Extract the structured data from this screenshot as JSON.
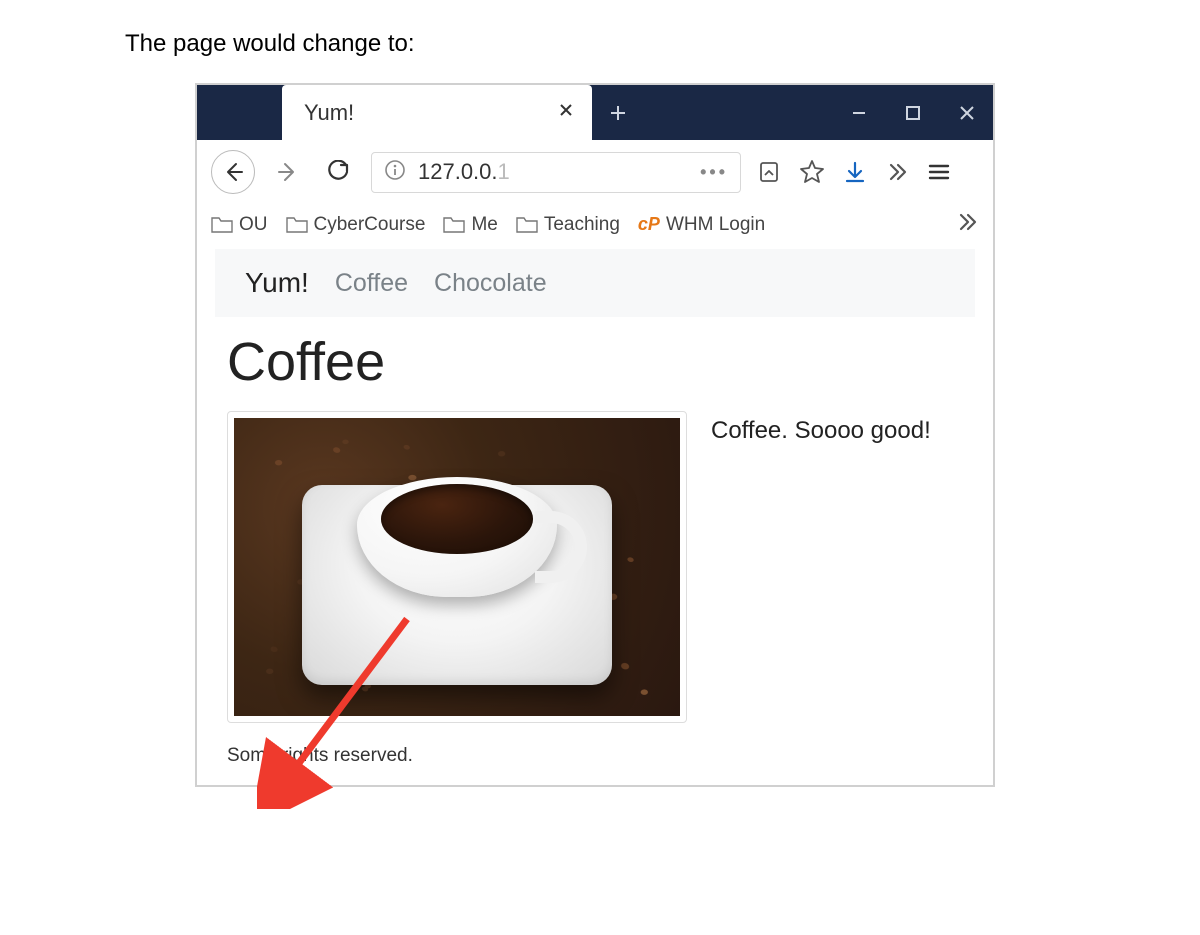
{
  "intro_caption": "The page would change to:",
  "browser": {
    "tab_title": "Yum!",
    "url_display": "127.0.0.",
    "url_faded": "1",
    "bookmarks": [
      "OU",
      "CyberCourse",
      "Me",
      "Teaching",
      "WHM Login"
    ]
  },
  "page": {
    "brand": "Yum!",
    "nav_links": [
      "Coffee",
      "Chocolate"
    ],
    "heading": "Coffee",
    "image_caption": "Coffee. Soooo good!",
    "footer": "Some rights reserved."
  }
}
